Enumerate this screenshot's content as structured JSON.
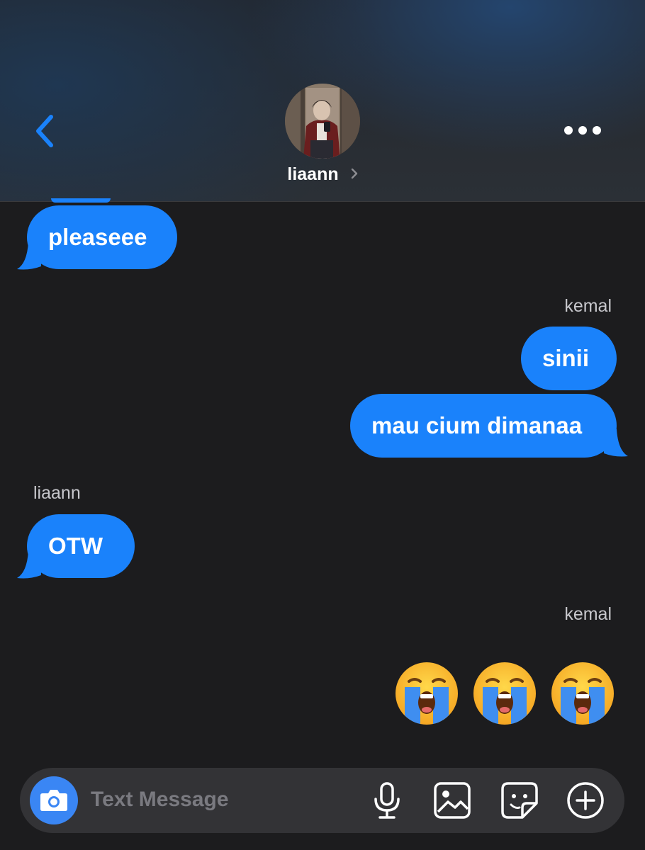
{
  "header": {
    "contact_name": "liaann",
    "back_icon": "chevron-left-icon",
    "avatar_icon": "contact-avatar-photo",
    "more_icon": "more-horizontal-icon"
  },
  "messages": [
    {
      "sender": "",
      "text": "pleaseee",
      "side": "left"
    },
    {
      "sender": "kemal",
      "text": "sinii",
      "side": "right"
    },
    {
      "sender": "",
      "text": "mau cium dimanaa",
      "side": "right"
    },
    {
      "sender": "liaann",
      "text": "OTW",
      "side": "left"
    },
    {
      "sender": "kemal",
      "text": "",
      "side": "right",
      "emojis": [
        "loudly-crying-face",
        "loudly-crying-face",
        "loudly-crying-face"
      ]
    }
  ],
  "composer": {
    "placeholder": "Text Message",
    "camera_icon": "camera-icon",
    "tools": [
      "microphone-icon",
      "image-icon",
      "sticker-icon",
      "plus-circle-icon"
    ]
  },
  "colors": {
    "background": "#1c1c1e",
    "bubble": "#1a82fb",
    "accent": "#1a82fb"
  }
}
